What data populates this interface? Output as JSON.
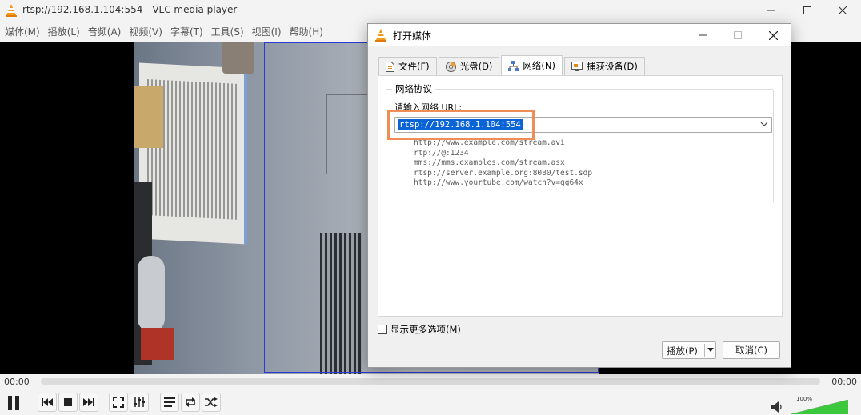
{
  "window": {
    "title": "rtsp://192.168.1.104:554 - VLC media player",
    "minimize_icon": "minimize-icon",
    "maximize_icon": "maximize-icon",
    "close_icon": "close-icon"
  },
  "menu": [
    "媒体(M)",
    "播放(L)",
    "音频(A)",
    "视频(V)",
    "字幕(T)",
    "工具(S)",
    "视图(I)",
    "帮助(H)"
  ],
  "seek": {
    "elapsed": "00:00",
    "remaining": "00:00",
    "progress": 0
  },
  "volume": {
    "label": "100%",
    "level": 1.0
  },
  "dialog": {
    "title": "打开媒体",
    "tabs": [
      {
        "label": "文件(F)",
        "icon": "file-icon"
      },
      {
        "label": "光盘(D)",
        "icon": "disc-icon"
      },
      {
        "label": "网络(N)",
        "icon": "network-icon",
        "active": true
      },
      {
        "label": "捕获设备(D)",
        "icon": "capture-device-icon"
      }
    ],
    "group_title": "网络协议",
    "url_label": "请输入网络 URL:",
    "url_value": "rtsp://192.168.1.104:554",
    "examples": [
      "http://www.example.com/stream.avi",
      "rtp://@:1234",
      "mms://mms.examples.com/stream.asx",
      "rtsp://server.example.org:8080/test.sdp",
      "http://www.yourtube.com/watch?v=gg64x"
    ],
    "more_options": "显示更多选项(M)",
    "play_button": "播放(P)",
    "cancel_button": "取消(C)"
  },
  "colors": {
    "selection": "#0a64d6",
    "annotation_box": "#f08c55",
    "video_selection_border": "#2a3bd1",
    "volume_fill": "#3cc83c"
  }
}
